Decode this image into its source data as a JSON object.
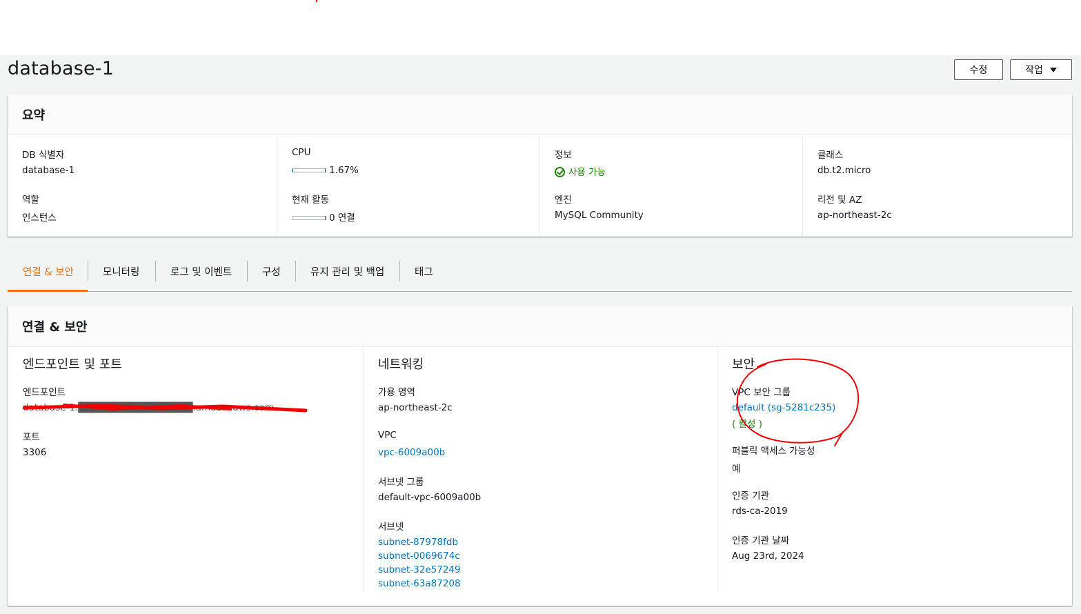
{
  "page": {
    "title": "database-1"
  },
  "buttons": {
    "edit": "수정",
    "actions": "작업"
  },
  "summary": {
    "title": "요약",
    "db_id_label": "DB 식별자",
    "db_id": "database-1",
    "role_label": "역할",
    "role": "인스턴스",
    "cpu_label": "CPU",
    "cpu": "1.67%",
    "cpu_fraction": 0.0167,
    "activity_label": "현재 활동",
    "activity": "0 연결",
    "status_label": "정보",
    "status": "사용 가능",
    "engine_label": "엔진",
    "engine": "MySQL Community",
    "class_label": "클래스",
    "class": "db.t2.micro",
    "region_label": "리전 및 AZ",
    "region": "ap-northeast-2c"
  },
  "tabs": [
    "연결 & 보안",
    "모니터링",
    "로그 및 이벤트",
    "구성",
    "유지 관리 및 백업",
    "태그"
  ],
  "conn": {
    "title": "연결 & 보안",
    "endpoint_section": {
      "title": "엔드포인트 및 포트",
      "endpoint_label": "엔드포인트",
      "endpoint": "database-1.████████████████.amazonaws.com",
      "port_label": "포트",
      "port": "3306"
    },
    "network_section": {
      "title": "네트워킹",
      "az_label": "가용 영역",
      "az": "ap-northeast-2c",
      "vpc_label": "VPC",
      "vpc": "vpc-6009a00b",
      "subnet_group_label": "서브넷 그룹",
      "subnet_group": "default-vpc-6009a00b",
      "subnets_label": "서브넷",
      "subnets": [
        "subnet-87978fdb",
        "subnet-0069674c",
        "subnet-32e57249",
        "subnet-63a87208"
      ]
    },
    "security_section": {
      "title": "보안",
      "sg_label": "VPC 보안 그룹",
      "sg": "default (sg-5281c235)",
      "sg_status": "( 활성 )",
      "public_label": "퍼블릭 액세스 가능성",
      "public": "예",
      "ca_label": "인증 기관",
      "ca": "rds-ca-2019",
      "ca_date_label": "인증 기관 날짜",
      "ca_date": "Aug 23rd, 2024"
    }
  },
  "colors": {
    "accent": "#ec7211",
    "link": "#0073bb",
    "success": "#1d8102",
    "annotation": "#e00000"
  }
}
